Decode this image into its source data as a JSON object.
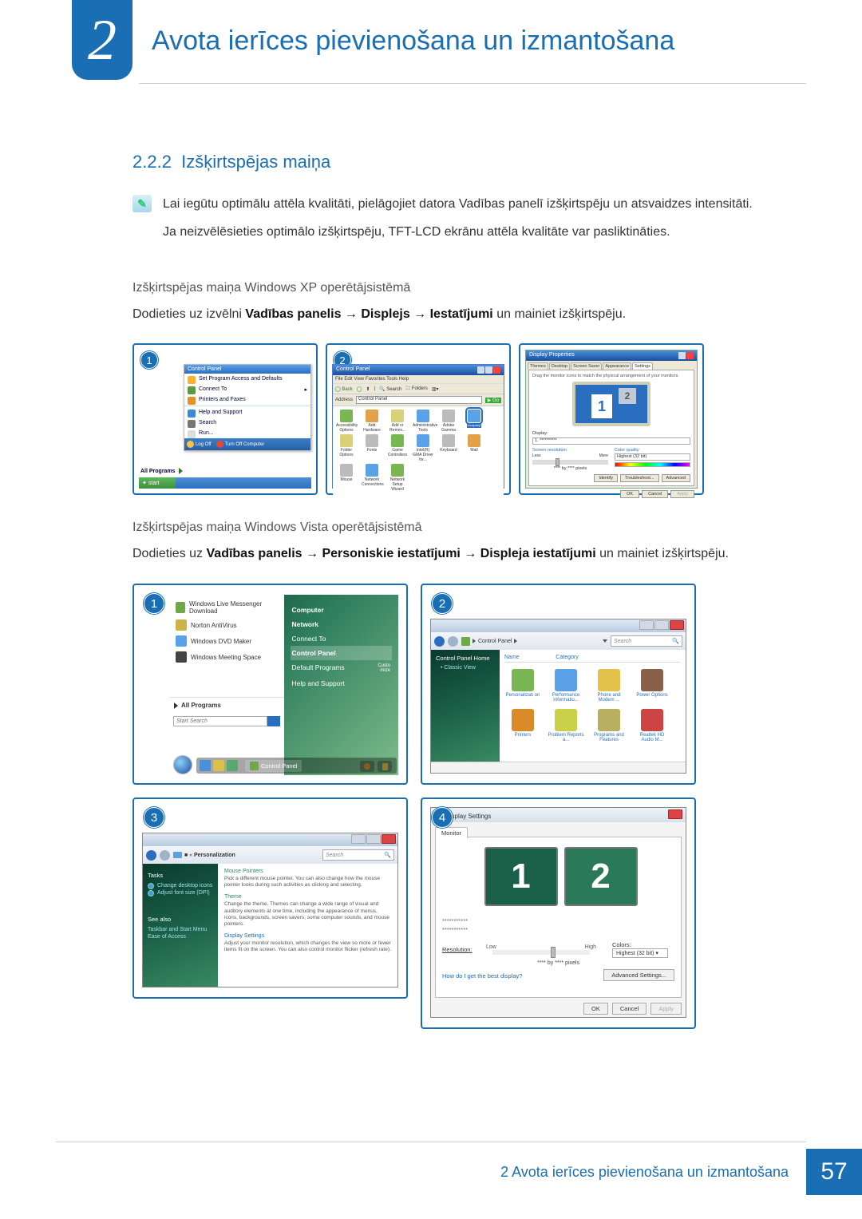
{
  "chapter": {
    "number": "2",
    "title": "Avota ierīces pievienošana un izmantošana"
  },
  "section": {
    "number": "2.2.2",
    "title": "Izšķirtspējas maiņa"
  },
  "note": {
    "line1": "Lai iegūtu optimālu attēla kvalitāti, pielāgojiet datora Vadības panelī izšķirtspēju un atsvaidzes intensitāti.",
    "line2": "Ja neizvēlēsieties optimālo izšķirtspēju, TFT-LCD ekrānu attēla kvalitāte var pasliktināties."
  },
  "xp": {
    "heading": "Izšķirtspējas maiņa Windows XP operētājsistēmā",
    "instr_prefix": "Dodieties uz izvēlni ",
    "instr_b1": "Vadības panelis",
    "arrow": " → ",
    "instr_b2": "Displejs",
    "instr_b3": "Iestatījumi",
    "instr_suffix": " un mainiet izšķirtspēju.",
    "shot1": {
      "badge": "1",
      "head": "Control Panel",
      "items": [
        "Set Program Access and Defaults",
        "Connect To",
        "Printers and Faxes",
        "Help and Support",
        "Search",
        "Run..."
      ],
      "all_programs": "All Programs",
      "logoff": "Log Off",
      "turnoff": "Turn Off Computer",
      "start": "start"
    },
    "shot2": {
      "badge": "2",
      "title": "Control Panel",
      "menubar": "File   Edit   View   Favorites   Tools   Help",
      "toolbar_back": "Back",
      "toolbar_search": "Search",
      "toolbar_folders": "Folders",
      "address_label": "Address",
      "address_value": "Control Panel",
      "go": "Go",
      "icons": [
        "Accessibility Options",
        "Add Hardware",
        "Add or Remov...",
        "Administrative Tools",
        "Adobe Gamma",
        "Display",
        "Folder Options",
        "Fonts",
        "Game Controllers",
        "Intel(R) GMA Driver for...",
        "Keyboard",
        "Mail",
        "Mouse",
        "Network Connections",
        "Network Setup Wizard"
      ]
    },
    "shot3": {
      "badge": "3",
      "title": "Display Properties",
      "tabs": [
        "Themes",
        "Desktop",
        "Screen Saver",
        "Appearance",
        "Settings"
      ],
      "hint": "Drag the monitor icons to match the physical arrangement of your monitors.",
      "mon1": "1",
      "mon2": "2",
      "display_label": "Display:",
      "display_value": "1. **********",
      "res_label": "Screen resolution",
      "less": "Less",
      "more": "More",
      "by": "**** by **** pixels",
      "cq_label": "Color quality",
      "cq_value": "Highest (32 bit)",
      "btn_identify": "Identify",
      "btn_trouble": "Troubleshoot...",
      "btn_adv": "Advanced",
      "ok": "OK",
      "cancel": "Cancel",
      "apply": "Apply"
    }
  },
  "vista": {
    "heading": "Izšķirtspējas maiņa Windows Vista operētājsistēmā",
    "instr_prefix": "Dodieties uz ",
    "instr_b1": "Vadības panelis",
    "instr_b2": "Personiskie iestatījumi",
    "instr_b3": "Displeja iestatījumi",
    "instr_suffix": " un mainiet izšķirtspēju.",
    "box1": {
      "badge": "1",
      "left_items": [
        "Windows Live Messenger Download",
        "Norton AntiVirus",
        "Windows DVD Maker",
        "Windows Meeting Space"
      ],
      "all_programs": "All Programs",
      "search_placeholder": "Start Search",
      "right_items": [
        "Computer",
        "Network",
        "Connect To",
        "Control Panel",
        "Default Programs",
        "Help and Support"
      ],
      "right_extra": "Custo\nmize",
      "task_label": "Control Panel"
    },
    "box2": {
      "badge": "2",
      "crumb": "Control Panel",
      "search_placeholder": "Search",
      "side_head": "Control Panel Home",
      "side_item": "Classic View",
      "col_name": "Name",
      "col_cat": "Category",
      "icons": [
        "Personalizati\non",
        "Performance Informatio...",
        "Phone and Modem ...",
        "Power Options",
        "Printers",
        "Problem Reports a...",
        "Programs and Features",
        "Realtek HD Audio M..."
      ]
    },
    "box3": {
      "badge": "3",
      "crumb": "Personalization",
      "search_placeholder": "Search",
      "side_tasks": "Tasks",
      "side_t1": "Change desktop icons",
      "side_t2": "Adjust font size (DPI)",
      "side_seealso": "See also",
      "side_s1": "Taskbar and Start Menu",
      "side_s2": "Ease of Access",
      "items": [
        {
          "link": "Mouse Pointers",
          "desc": "Pick a different mouse pointer. You can also change how the mouse pointer looks during such activities as clicking and selecting."
        },
        {
          "link": "Theme",
          "desc": "Change the theme. Themes can change a wide range of visual and auditory elements at one time, including the appearance of menus, icons, backgrounds, screen savers, some computer sounds, and mouse pointers."
        },
        {
          "link": "Display Settings",
          "desc": "Adjust your monitor resolution, which changes the view so more or fewer items fit on the screen. You can also control monitor flicker (refresh rate)."
        }
      ]
    },
    "box4": {
      "badge": "4",
      "title": "Display Settings",
      "tab": "Monitor",
      "mon1": "1",
      "mon2": "2",
      "stars1": "***********",
      "stars2": "***********",
      "res": "Resolution:",
      "low": "Low",
      "high": "High",
      "by": "**** by **** pixels",
      "colors": "Colors:",
      "colors_val": "Highest (32 bit)",
      "link": "How do I get the best display?",
      "adv": "Advanced Settings...",
      "ok": "OK",
      "cancel": "Cancel",
      "apply": "Apply"
    }
  },
  "footer": {
    "text_prefix": "2 ",
    "text": "Avota ierīces pievienošana un izmantošana",
    "page": "57"
  }
}
